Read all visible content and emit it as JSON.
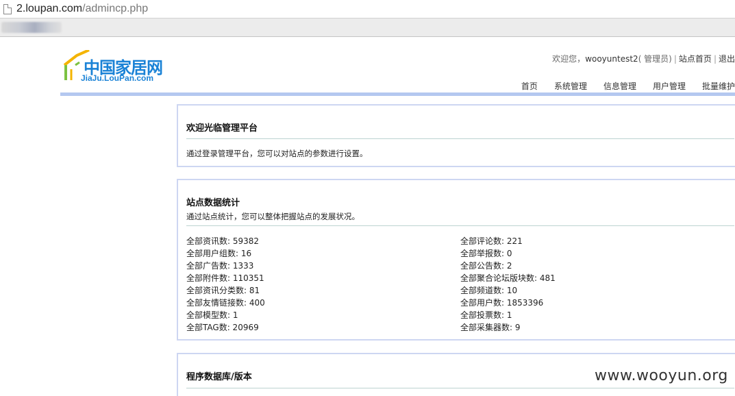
{
  "browser": {
    "url_host": "2.loupan.com",
    "url_path": "/admincp.php"
  },
  "logo": {
    "cn": "中国家居网",
    "en": "JiaJu.LouPan.com"
  },
  "userbar": {
    "welcome": "欢迎您，",
    "username": "wooyuntest2",
    "role": "( 管理员)",
    "home_link": "站点首页",
    "logout_link": "退出"
  },
  "nav": {
    "items": [
      "首页",
      "系统管理",
      "信息管理",
      "用户管理",
      "批量维护"
    ]
  },
  "welcome_panel": {
    "title": "欢迎光临管理平台",
    "text": "通过登录管理平台，您可以对站点的参数进行设置。"
  },
  "stats_panel": {
    "title": "站点数据统计",
    "desc": "通过站点统计，您可以整体把握站点的发展状况。",
    "left": [
      "全部资讯数: 59382",
      "全部用户组数: 16",
      "全部广告数: 1333",
      "全部附件数: 110351",
      "全部资讯分类数: 81",
      "全部友情链接数: 400",
      "全部模型数: 1",
      "全部TAG数: 20969"
    ],
    "right": [
      "全部评论数: 221",
      "全部举报数: 0",
      "全部公告数: 2",
      "全部聚合论坛版块数: 481",
      "全部频道数: 10",
      "全部用户数: 1853396",
      "全部投票数: 1",
      "全部采集器数: 9"
    ]
  },
  "db_panel": {
    "title": "程序数据库/版本"
  },
  "watermark": "www.wooyun.org",
  "colors": {
    "brand_blue": "#1a82d6",
    "header_line": "#b4c8f0",
    "panel_border": "#cdd6f2"
  }
}
